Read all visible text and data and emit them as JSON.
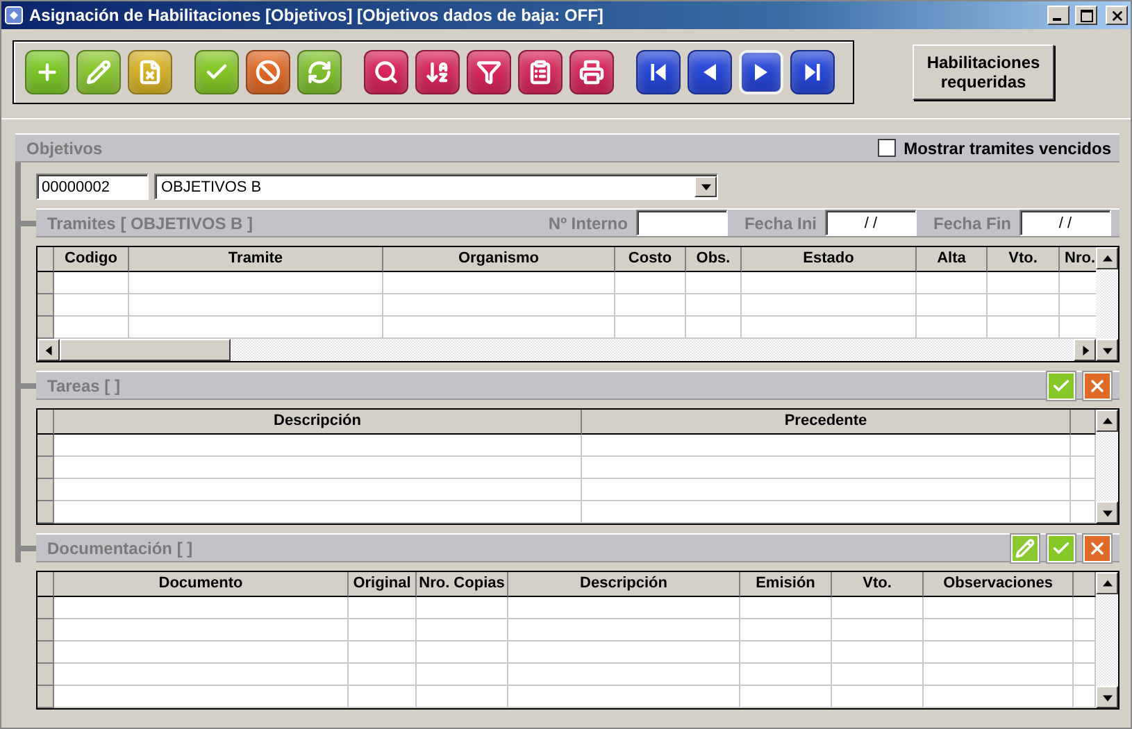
{
  "window": {
    "title": "Asignación de Habilitaciones [Objetivos] [Objetivos dados de baja: OFF]"
  },
  "toolbar": {
    "groups": [
      {
        "buttons": [
          {
            "kind": "add",
            "color": "#7ec82a",
            "selected": false
          },
          {
            "kind": "edit",
            "color": "#8cc832",
            "selected": false
          },
          {
            "kind": "delete",
            "color": "#d8b428",
            "selected": false
          }
        ]
      },
      {
        "buttons": [
          {
            "kind": "accept",
            "color": "#86c828",
            "selected": false
          },
          {
            "kind": "cancel",
            "color": "#e06a28",
            "selected": false
          },
          {
            "kind": "refresh",
            "color": "#80c030",
            "selected": false
          }
        ]
      },
      {
        "buttons": [
          {
            "kind": "search",
            "color": "#d8285c",
            "selected": false
          },
          {
            "kind": "sort",
            "color": "#d8285c",
            "selected": false
          },
          {
            "kind": "filter",
            "color": "#d8285c",
            "selected": false
          },
          {
            "kind": "report",
            "color": "#d8285c",
            "selected": false
          },
          {
            "kind": "print",
            "color": "#d8285c",
            "selected": false
          }
        ]
      },
      {
        "buttons": [
          {
            "kind": "first",
            "color": "#2848d8",
            "selected": false
          },
          {
            "kind": "previous",
            "color": "#2848d8",
            "selected": false
          },
          {
            "kind": "next",
            "color": "#2848d8",
            "selected": true
          },
          {
            "kind": "last",
            "color": "#2848d8",
            "selected": false
          }
        ]
      }
    ]
  },
  "required_button": {
    "label": "Habilitaciones requeridas"
  },
  "objetivos": {
    "title": "Objetivos",
    "show_expired": {
      "label": "Mostrar tramites vencidos",
      "checked": false
    },
    "code": "00000002",
    "name": "OBJETIVOS B"
  },
  "tramites": {
    "title": "Tramites [ OBJETIVOS B ]",
    "filters": [
      {
        "label": "Nº Interno"
      },
      {
        "label": "Fecha Ini",
        "value": "/ /"
      },
      {
        "label": "Fecha Fin",
        "value": "/ /"
      }
    ],
    "columns": [
      "Codigo",
      "Tramite",
      "Organismo",
      "Costo",
      "Obs.",
      "Estado",
      "Alta",
      "Vto.",
      "Nro."
    ]
  },
  "tareas": {
    "title": "Tareas [ ]",
    "actions": [
      {
        "kind": "accept"
      },
      {
        "kind": "cancel"
      }
    ],
    "columns": [
      "Descripción",
      "Precedente"
    ]
  },
  "documentacion": {
    "title": "Documentación [ ]",
    "actions": [
      {
        "kind": "edit"
      },
      {
        "kind": "accept"
      },
      {
        "kind": "cancel"
      }
    ],
    "columns": [
      "Documento",
      "Original",
      "Nro. Copias",
      "Descripción",
      "Emisión",
      "Vto.",
      "Observaciones"
    ]
  }
}
